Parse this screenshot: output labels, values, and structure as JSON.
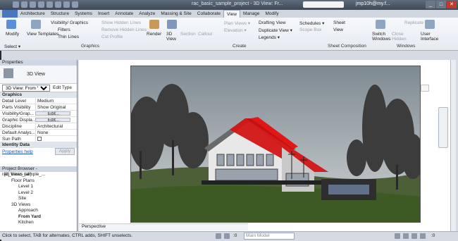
{
  "window": {
    "title": "rac_basic_sample_project - 3D View: Fr...",
    "user": "jmp10h@my.f..."
  },
  "tabs": [
    "Architecture",
    "Structure",
    "Systems",
    "Insert",
    "Annotate",
    "Analyze",
    "Massing & Site",
    "Collaborate",
    "View",
    "Manage",
    "Modify"
  ],
  "active_tab": "View",
  "ribbon": {
    "modify": "Modify",
    "select": "Select ▾",
    "view_templates": "View Templates",
    "visibility_graphics": "Visibility/ Graphics",
    "filters": "Filters",
    "thin_lines": "Thin Lines",
    "show_hidden_lines": "Show Hidden Lines",
    "remove_hidden_lines": "Remove Hidden Lines",
    "cut_profile": "Cut Profile",
    "render": "Render",
    "graphics_panel": "Graphics",
    "view_3d": "3D View",
    "section": "Section",
    "callout": "Callout",
    "plan_views": "Plan Views ▾",
    "elevation": "Elevation ▾",
    "drafting_view": "Drafting View",
    "duplicate_view": "Duplicate View ▾",
    "legends": "Legends ▾",
    "schedules": "Schedules ▾",
    "scope_box": "Scope Box",
    "create_panel": "Create",
    "sheet": "Sheet",
    "view_sc": "View",
    "sheet_comp_panel": "Sheet Composition",
    "switch_windows": "Switch Windows",
    "close_hidden": "Close Hidden",
    "replicate": "Replicate",
    "user_interface": "User Interface",
    "windows_panel": "Windows"
  },
  "properties": {
    "title": "Properties",
    "type": "3D View",
    "filter": "3D View: From Yard",
    "edit_type": "Edit Type",
    "group_graphics": "Graphics",
    "rows": [
      {
        "k": "Detail Level",
        "v": "Medium"
      },
      {
        "k": "Parts Visibility",
        "v": "Show Original"
      },
      {
        "k": "Visibility/Grap...",
        "v": "Edit..."
      },
      {
        "k": "Graphic Displa...",
        "v": "Edit..."
      },
      {
        "k": "Discipline",
        "v": "Architectural"
      },
      {
        "k": "Default Analys...",
        "v": "None"
      },
      {
        "k": "Sun Path",
        "v": ""
      }
    ],
    "group_identity": "Identity Data",
    "help": "Properties help",
    "apply": "Apply"
  },
  "browser": {
    "title": "Project Browser - rac_basic_sample_...",
    "items": [
      {
        "t": "[0] Views (all)",
        "lvl": 0
      },
      {
        "t": "Floor Plans",
        "lvl": 1
      },
      {
        "t": "Level 1",
        "lvl": 2
      },
      {
        "t": "Level 2",
        "lvl": 2
      },
      {
        "t": "Site",
        "lvl": 2
      },
      {
        "t": "3D Views",
        "lvl": 1
      },
      {
        "t": "Approach",
        "lvl": 2
      },
      {
        "t": "From Yard",
        "lvl": 2,
        "sel": true
      },
      {
        "t": "Kitchen",
        "lvl": 2
      }
    ]
  },
  "view_control": {
    "scale": "Perspective"
  },
  "status": {
    "text": "Click to select, TAB for alternates, CTRL adds, SHIFT unselects.",
    "model": "Main Model",
    "zero": ":0"
  }
}
